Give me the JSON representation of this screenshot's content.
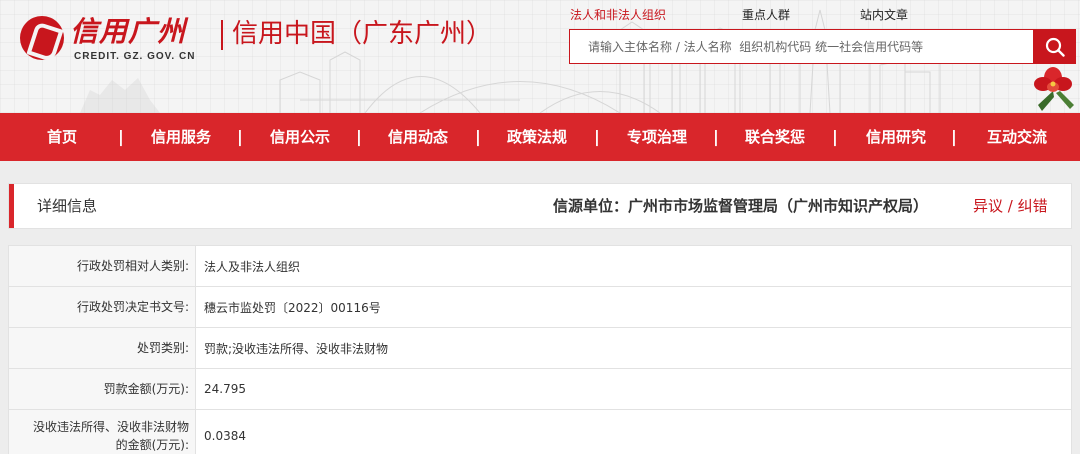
{
  "header": {
    "logo_cn": "信用广州",
    "logo_en": "CREDIT. GZ. GOV. CN",
    "site_title": "信用中国（广东广州）",
    "top_links": [
      "法人和非法人组织",
      "重点人群",
      "站内文章"
    ],
    "search_placeholder": "请输入主体名称 / 法人名称  组织机构代码 统一社会信用代码等",
    "search_icon": "search-icon"
  },
  "nav": {
    "items": [
      "首页",
      "信用服务",
      "信用公示",
      "信用动态",
      "政策法规",
      "专项治理",
      "联合奖惩",
      "信用研究",
      "互动交流"
    ],
    "separator": "|"
  },
  "panel": {
    "title": "详细信息",
    "source": "信源单位：广州市市场监督管理局（广州市知识产权局）",
    "dispute": "异议 / 纠错"
  },
  "details": [
    {
      "label": "行政处罚相对人类别:",
      "value": "法人及非法人组织"
    },
    {
      "label": "行政处罚决定书文号:",
      "value": "穗云市监处罚〔2022〕00116号"
    },
    {
      "label": "处罚类别:",
      "value": "罚款;没收违法所得、没收非法财物"
    },
    {
      "label": "罚款金额(万元):",
      "value": "24.795"
    },
    {
      "label": "没收违法所得、没收非法财物的金额(万元):",
      "label_line1": "没收违法所得、没收非法财物",
      "label_line2": "的金额(万元):",
      "value": "0.0384"
    }
  ],
  "colors": {
    "brand_red": "#c8161d",
    "nav_red": "#d9262b"
  }
}
